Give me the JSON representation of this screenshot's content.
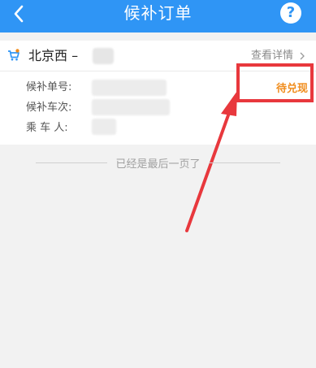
{
  "header": {
    "title": "候补订单",
    "help_label": "?"
  },
  "order": {
    "route_text": "北京西 –",
    "detail_label": "查看详情",
    "fields": [
      {
        "label": "候补单号:"
      },
      {
        "label": "候补车次:"
      },
      {
        "label": "乘 车 人:"
      }
    ],
    "status": "待兑现"
  },
  "footer": {
    "end_text": "已经是最后一页了"
  },
  "colors": {
    "topbar": "#2f95f5",
    "status": "#f08c1c",
    "annotation": "#e8383d"
  }
}
